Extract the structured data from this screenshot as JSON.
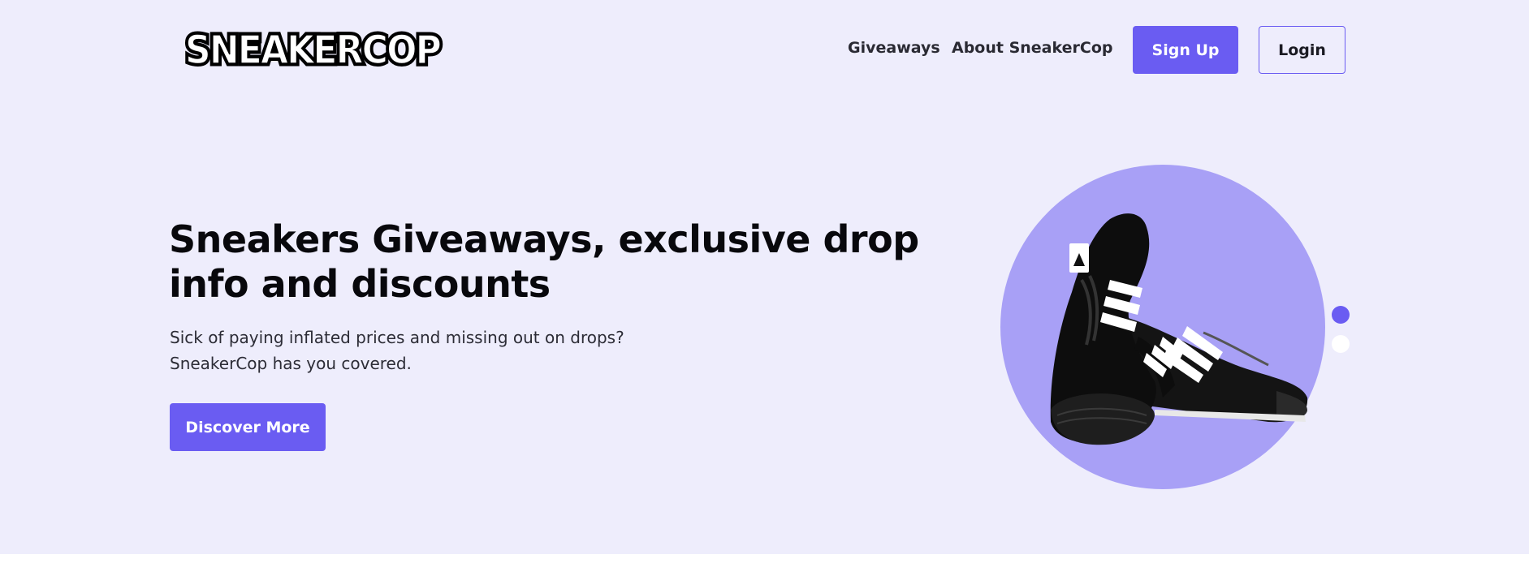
{
  "header": {
    "logo_text": "SNEAKERCOP",
    "nav": [
      {
        "label": "Giveaways"
      },
      {
        "label": "About SneakerCop"
      }
    ],
    "signup_label": "Sign Up",
    "login_label": "Login"
  },
  "hero": {
    "headline": "Sneakers Giveaways, exclusive drop info and discounts",
    "subtext_line1": "Sick of paying inflated prices and missing out on drops?",
    "subtext_line2": "SneakerCop has you covered.",
    "cta_label": "Discover More",
    "slider": {
      "total": 2,
      "active": 1
    }
  },
  "colors": {
    "accent": "#6a5cf2",
    "hero_background": "#eeedfc",
    "circle": "#a8a0f6"
  },
  "icons": [
    "sneakercop-logo",
    "sneaker-image",
    "carousel-dot"
  ]
}
